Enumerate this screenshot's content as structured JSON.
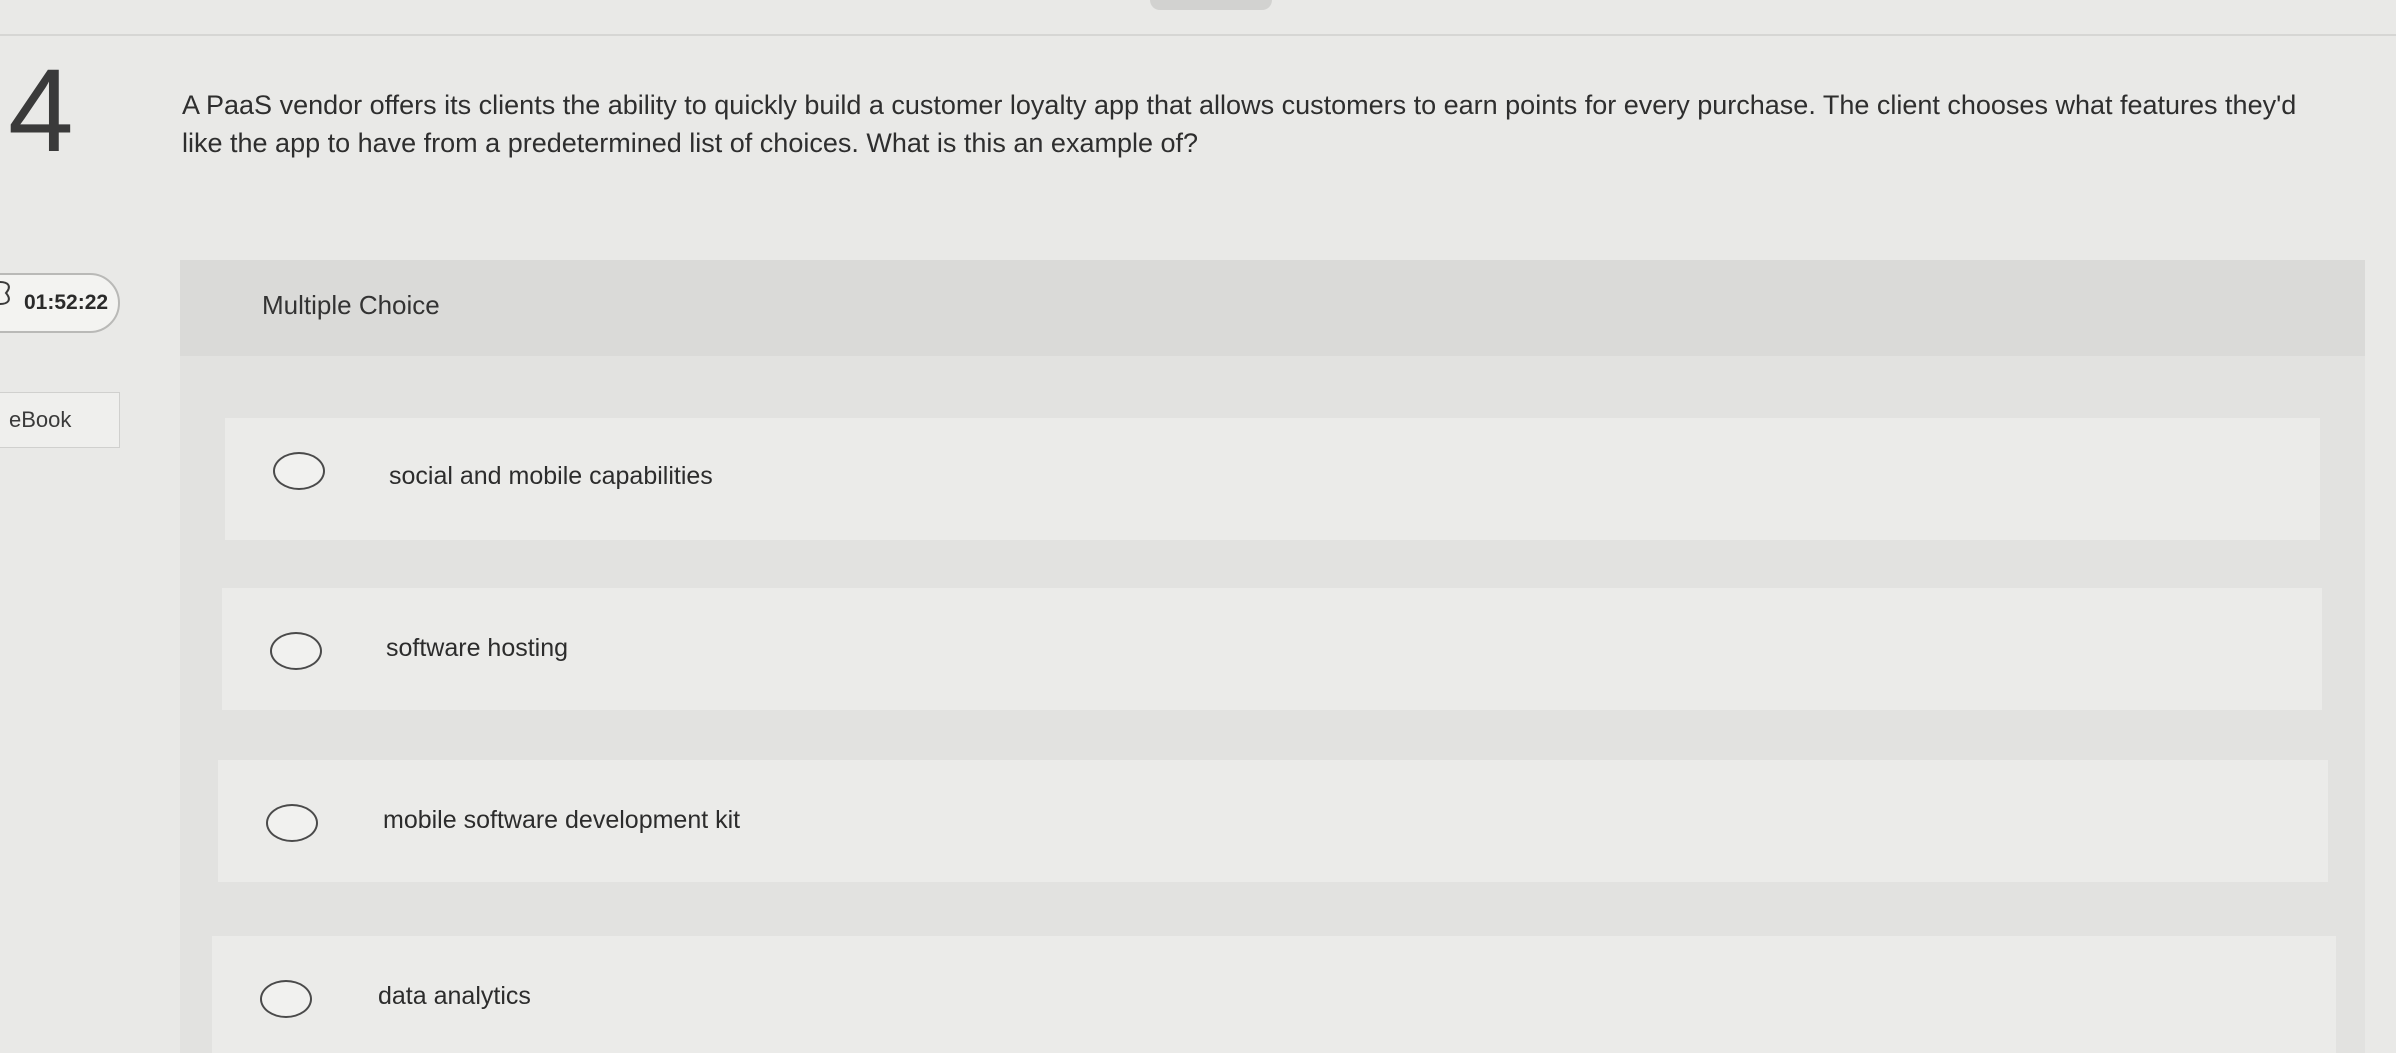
{
  "question": {
    "number": "4",
    "text": "A PaaS vendor offers its clients the ability to quickly build a customer loyalty app that allows customers to earn points for every purchase. The client chooses what features they'd like the app to have from a predetermined list of choices. What is this an example of?"
  },
  "timer": {
    "value": "01:52:22"
  },
  "ebook": {
    "label": "eBook"
  },
  "answer_panel": {
    "type_label": "Multiple Choice",
    "options": [
      {
        "label": "social and mobile capabilities"
      },
      {
        "label": "software hosting"
      },
      {
        "label": "mobile software development kit"
      },
      {
        "label": "data analytics"
      }
    ]
  }
}
